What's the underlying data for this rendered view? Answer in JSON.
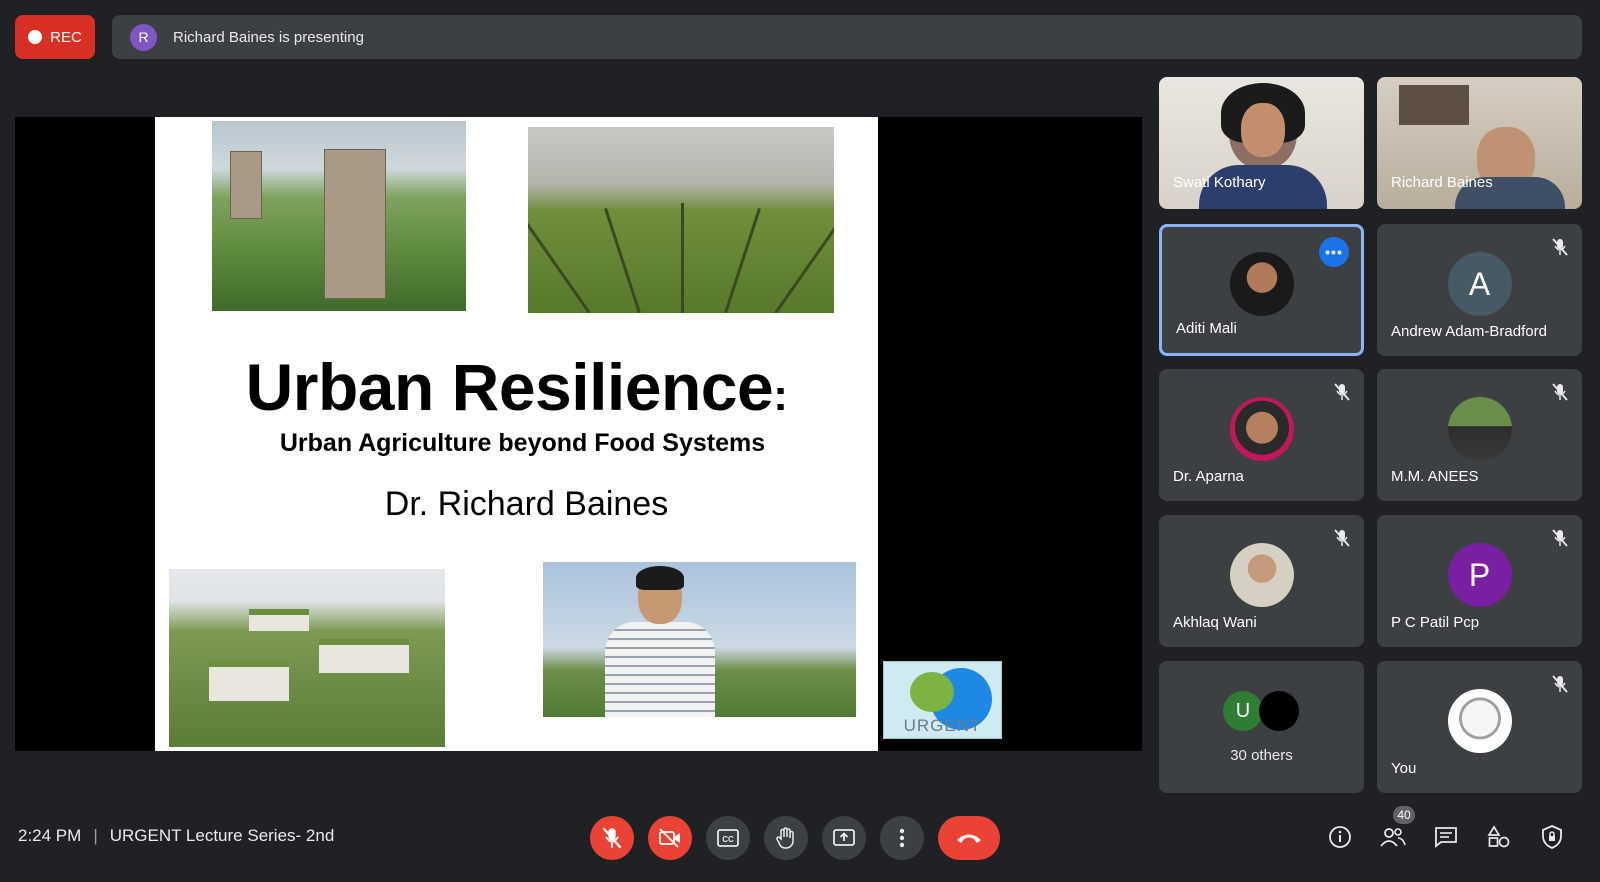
{
  "recording": {
    "label": "REC"
  },
  "presenter_bar": {
    "avatar_initial": "R",
    "text": "Richard Baines is presenting"
  },
  "slide": {
    "title": "Urban Resilience",
    "title_colon": ":",
    "subtitle": "Urban Agriculture beyond Food Systems",
    "author": "Dr. Richard Baines",
    "logo_text": "URGENT"
  },
  "participants": [
    {
      "name": "Swati Kothary",
      "type": "video"
    },
    {
      "name": "Richard Baines",
      "type": "video"
    },
    {
      "name": "Aditi Mali",
      "type": "photo",
      "active": true
    },
    {
      "name": "Andrew Adam-Bradford",
      "type": "letter",
      "initial": "A",
      "color": "#455a64",
      "muted": true
    },
    {
      "name": "Dr. Aparna",
      "type": "photo",
      "muted": true
    },
    {
      "name": "M.M. ANEES",
      "type": "photo",
      "muted": true
    },
    {
      "name": "Akhlaq Wani",
      "type": "photo",
      "muted": true
    },
    {
      "name": "P C Patil Pcp",
      "type": "letter",
      "initial": "P",
      "color": "#7b1fa2",
      "muted": true
    },
    {
      "name": "You",
      "type": "photo",
      "muted": true
    }
  ],
  "others": {
    "initial": "U",
    "label": "30 others"
  },
  "bottom_bar": {
    "time": "2:24 PM",
    "separator": "|",
    "meeting_title": "URGENT Lecture Series- 2nd",
    "participant_count": "40"
  },
  "colors": {
    "background": "#202124",
    "tile": "#3c4043",
    "danger": "#ea4335",
    "accent": "#8ab4f8"
  },
  "icons": [
    "mic-off-icon",
    "camera-off-icon",
    "captions-icon",
    "raise-hand-icon",
    "present-icon",
    "more-options-icon",
    "end-call-icon",
    "info-icon",
    "people-icon",
    "chat-icon",
    "activities-icon",
    "host-controls-icon"
  ]
}
